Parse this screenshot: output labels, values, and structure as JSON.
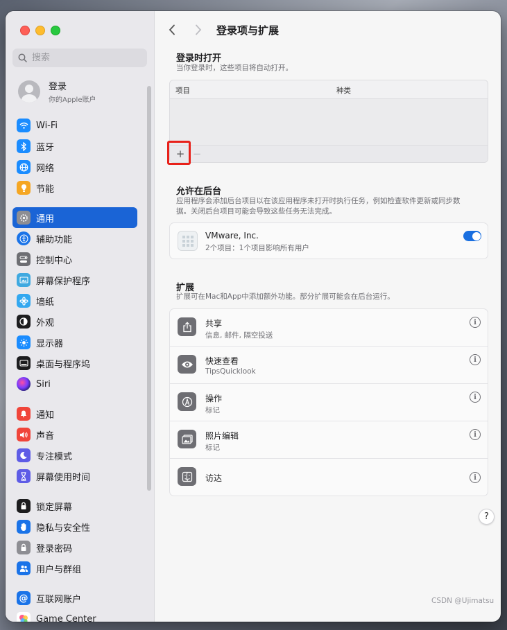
{
  "sidebar": {
    "search_placeholder": "搜索",
    "account": {
      "name": "登录",
      "subtitle": "你的Apple账户"
    },
    "items": [
      {
        "label": "Wi-Fi",
        "icon": "wifi-icon",
        "color": "#1a8cff"
      },
      {
        "label": "蓝牙",
        "icon": "bluetooth-icon",
        "color": "#1a8cff"
      },
      {
        "label": "网络",
        "icon": "globe-icon",
        "color": "#1a8cff"
      },
      {
        "label": "节能",
        "icon": "bulb-icon",
        "color": "#f5a623"
      },
      {
        "label": "通用",
        "icon": "gear-icon",
        "color": "#8e8e93"
      },
      {
        "label": "辅助功能",
        "icon": "accessibility-icon",
        "color": "#1a73e8"
      },
      {
        "label": "控制中心",
        "icon": "control-center-icon",
        "color": "#6e6e73"
      },
      {
        "label": "屏幕保护程序",
        "icon": "screensaver-icon",
        "color": "#3fa9e0"
      },
      {
        "label": "墙纸",
        "icon": "wallpaper-icon",
        "color": "#33a8f0"
      },
      {
        "label": "外观",
        "icon": "appearance-icon",
        "color": "#1d1d1f"
      },
      {
        "label": "显示器",
        "icon": "display-icon",
        "color": "#1a8cff"
      },
      {
        "label": "桌面与程序坞",
        "icon": "dock-icon",
        "color": "#1d1d1f"
      },
      {
        "label": "Siri",
        "icon": "siri-icon",
        "color": "#4a3aa8"
      },
      {
        "label": "通知",
        "icon": "bell-icon",
        "color": "#f0453a"
      },
      {
        "label": "声音",
        "icon": "speaker-icon",
        "color": "#f0453a"
      },
      {
        "label": "专注模式",
        "icon": "moon-icon",
        "color": "#5e5ce6"
      },
      {
        "label": "屏幕使用时间",
        "icon": "hourglass-icon",
        "color": "#5e5ce6"
      },
      {
        "label": "锁定屏幕",
        "icon": "lock-icon",
        "color": "#1d1d1f"
      },
      {
        "label": "隐私与安全性",
        "icon": "hand-icon",
        "color": "#1a73e8"
      },
      {
        "label": "登录密码",
        "icon": "password-lock-icon",
        "color": "#8e8e93"
      },
      {
        "label": "用户与群组",
        "icon": "users-icon",
        "color": "#1a73e8"
      },
      {
        "label": "互联网账户",
        "icon": "at-icon",
        "color": "#1a73e8"
      },
      {
        "label": "Game Center",
        "icon": "game-center-icon",
        "color": "#e84393"
      }
    ]
  },
  "header": {
    "title": "登录项与扩展"
  },
  "login_items": {
    "title": "登录时打开",
    "subtitle": "当你登录时，这些项目将自动打开。",
    "columns": [
      "项目",
      "种类"
    ],
    "add_label": "+",
    "remove_label": "−"
  },
  "background": {
    "title": "允许在后台",
    "subtitle": "应用程序会添加后台项目以在该应用程序未打开时执行任务，例如检查软件更新或同步数据。关闭后台项目可能会导致这些任务无法完成。",
    "items": [
      {
        "name": "VMware, Inc.",
        "detail": "2个项目：1个项目影响所有用户",
        "enabled": true
      }
    ]
  },
  "extensions": {
    "title": "扩展",
    "subtitle": "扩展可在Mac和App中添加额外功能。部分扩展可能会在后台运行。",
    "items": [
      {
        "name": "共享",
        "detail": "信息, 邮件, 隔空投送",
        "icon": "share-icon"
      },
      {
        "name": "快速查看",
        "detail": "TipsQuicklook",
        "icon": "eye-icon"
      },
      {
        "name": "操作",
        "detail": "标记",
        "icon": "markup-icon"
      },
      {
        "name": "照片编辑",
        "detail": "标记",
        "icon": "photos-icon"
      },
      {
        "name": "访达",
        "detail": "",
        "icon": "finder-icon"
      }
    ]
  },
  "help_label": "?",
  "watermark": "CSDN @Ujimatsu"
}
